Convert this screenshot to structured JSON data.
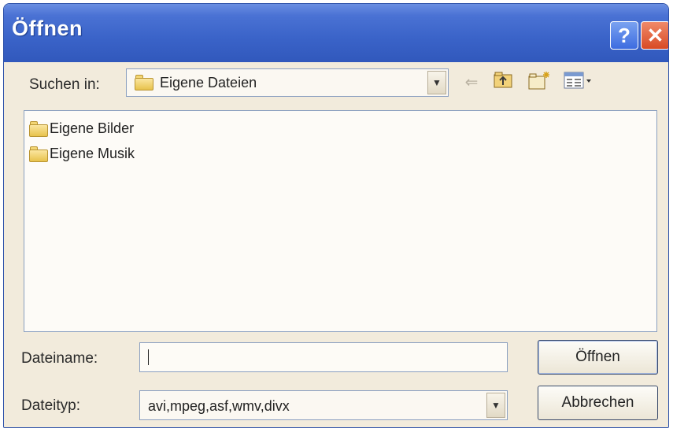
{
  "window": {
    "title": "Öffnen",
    "help_glyph": "?",
    "close_glyph": "✕"
  },
  "look_in": {
    "label": "Suchen in:",
    "value": "Eigene Dateien",
    "icon": "folder-icon"
  },
  "toolbar": {
    "back_icon": "back-arrow-icon",
    "up_icon": "up-folder-icon",
    "new_folder_icon": "new-folder-icon",
    "view_icon": "view-menu-icon"
  },
  "files": [
    {
      "name": "Eigene Bilder",
      "icon": "pictures-folder-icon"
    },
    {
      "name": "Eigene Musik",
      "icon": "music-folder-icon"
    }
  ],
  "filename": {
    "label": "Dateiname:",
    "value": ""
  },
  "filetype": {
    "label": "Dateityp:",
    "value": "avi,mpeg,asf,wmv,divx"
  },
  "buttons": {
    "open": "Öffnen",
    "cancel": "Abbrechen"
  },
  "colors": {
    "titlebar": "#3a63c8",
    "dialog_bg": "#f2ebdc",
    "close": "#d84a24"
  }
}
